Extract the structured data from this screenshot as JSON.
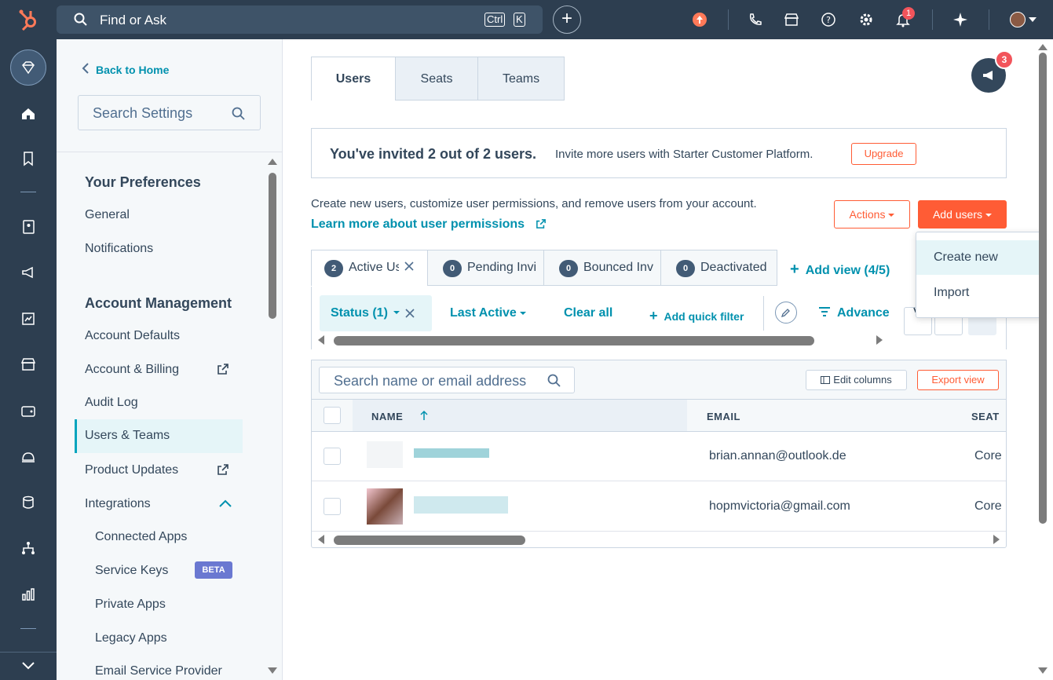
{
  "topbar": {
    "search_placeholder": "Find or Ask",
    "kbd_ctrl": "Ctrl",
    "kbd_k": "K",
    "notification_count": "1"
  },
  "settings": {
    "back_label": "Back to Home",
    "search_placeholder": "Search Settings",
    "sections": [
      {
        "title": "Your Preferences",
        "items": [
          "General",
          "Notifications"
        ]
      },
      {
        "title": "Account Management",
        "items": [
          "Account Defaults",
          "Account & Billing",
          "Audit Log",
          "Users & Teams",
          "Product Updates",
          "Integrations"
        ]
      }
    ],
    "integrations_sub": [
      "Connected Apps",
      "Service Keys",
      "Private Apps",
      "Legacy Apps",
      "Email Service Provider"
    ],
    "beta_label": "BETA",
    "active_item": "Users & Teams"
  },
  "main": {
    "tabs": [
      "Users",
      "Seats",
      "Teams"
    ],
    "broadcast_count": "3",
    "banner": {
      "headline": "You've invited 2 out of 2 users.",
      "text": "Invite more users with Starter Customer Platform.",
      "upgrade_label": "Upgrade"
    },
    "description": "Create new users, customize user permissions, and remove users from your account.",
    "learn_more": "Learn more about user permissions",
    "actions_label": "Actions",
    "add_users_label": "Add users",
    "dropdown": [
      "Create new",
      "Import"
    ],
    "view_tabs": [
      {
        "count": "2",
        "label": "Active Us"
      },
      {
        "count": "0",
        "label": "Pending Invi"
      },
      {
        "count": "0",
        "label": "Bounced Inv"
      },
      {
        "count": "0",
        "label": "Deactivated"
      }
    ],
    "add_view_label": "Add view (4/5)",
    "filters": {
      "status": "Status (1)",
      "last_active": "Last Active",
      "clear_all": "Clear all",
      "add_quick_filter": "Add quick filter",
      "advanced": "Advance"
    },
    "table": {
      "search_placeholder": "Search name or email address",
      "edit_columns": "Edit columns",
      "export_view": "Export view",
      "columns": [
        "NAME",
        "EMAIL",
        "SEAT"
      ],
      "rows": [
        {
          "email": "brian.annan@outlook.de",
          "seat": "Core"
        },
        {
          "email": "hopmvictoria@gmail.com",
          "seat": "Core"
        }
      ]
    }
  },
  "colors": {
    "accent": "#ff5c35",
    "link": "#0091ae",
    "nav": "#2d3e50"
  }
}
